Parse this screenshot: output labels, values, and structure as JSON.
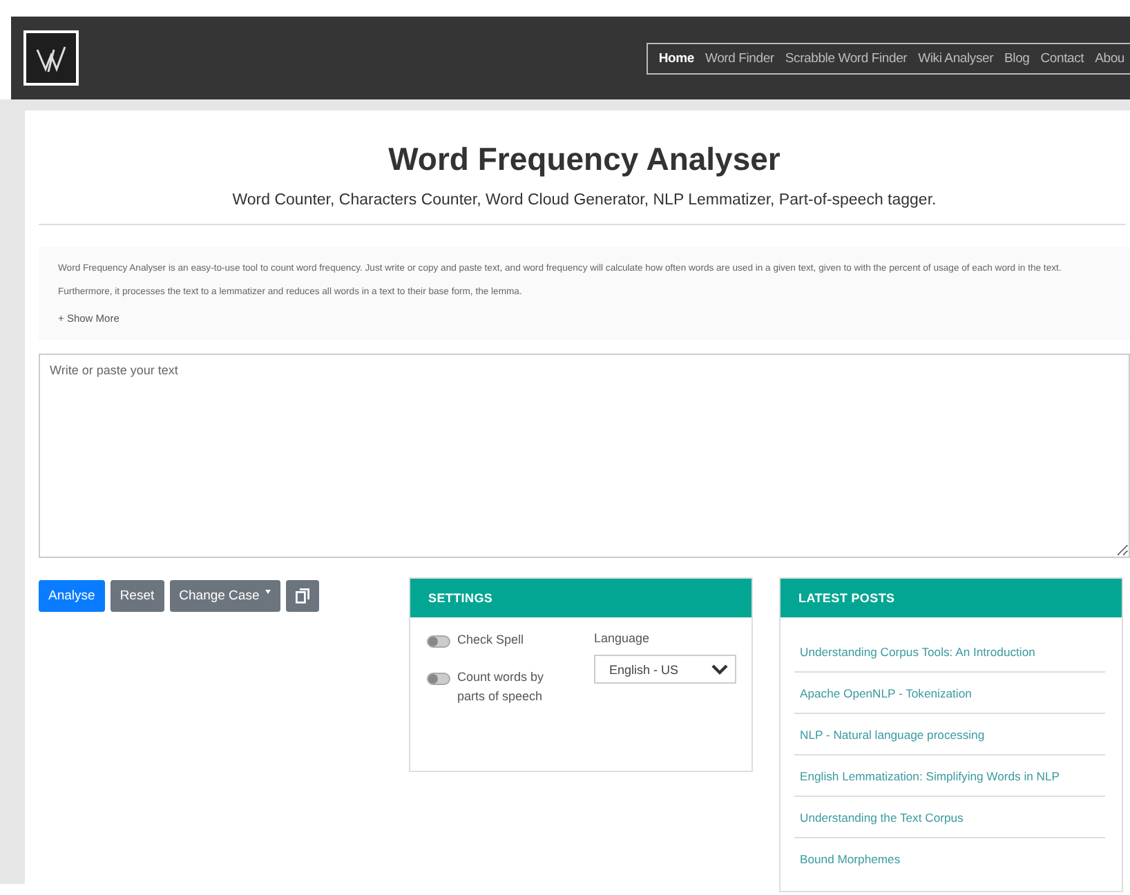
{
  "nav": {
    "items": [
      {
        "label": "Home",
        "selected": true
      },
      {
        "label": "Word Finder",
        "selected": false
      },
      {
        "label": "Scrabble Word Finder",
        "selected": false
      },
      {
        "label": "Wiki Analyser",
        "selected": false
      },
      {
        "label": "Blog",
        "selected": false
      },
      {
        "label": "Contact",
        "selected": false
      },
      {
        "label": "Abou",
        "selected": false
      }
    ]
  },
  "title": "Word Frequency Analyser",
  "subtitle": "Word Counter, Characters Counter, Word Cloud Generator, NLP Lemmatizer, Part-of-speech tagger.",
  "description": "Word Frequency Analyser is an easy-to-use tool to count word frequency. Just write or copy and paste text, and word frequency will calculate how often words are used in a given text, given to with the percent of usage of each word in the text. Furthermore, it processes the text to a lemmatizer and reduces all words in a text to their base form, the lemma.",
  "show_more": "+ Show More",
  "text_input": {
    "placeholder": "Write or paste your text"
  },
  "buttons": [
    {
      "label": "Analyse",
      "kind": "primary"
    },
    {
      "label": "Reset",
      "kind": "secondary"
    },
    {
      "label": "Change Case",
      "kind": "dropdown"
    },
    {
      "kind": "copy"
    }
  ],
  "settings": {
    "title": "SETTINGS",
    "toggles": [
      {
        "label": "Check Spell",
        "on": false
      },
      {
        "label": "Count words by parts of speech",
        "on": false
      }
    ],
    "language_label": "Language",
    "language_value": "English - US"
  },
  "latest_posts": {
    "title": "LATEST POSTS",
    "items": [
      "Understanding Corpus Tools: An Introduction",
      "Apache OpenNLP - Tokenization",
      "NLP - Natural language processing",
      "English Lemmatization: Simplifying Words in NLP",
      "Understanding the Text Corpus",
      "Bound Morphemes"
    ]
  }
}
